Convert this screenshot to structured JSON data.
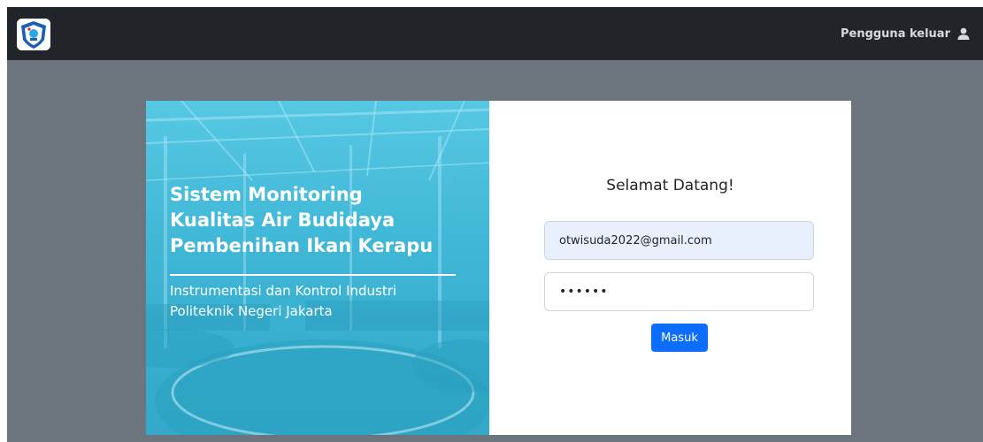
{
  "navbar": {
    "logo_icon": "institution-logo",
    "user_link_label": "Pengguna keluar",
    "user_icon": "user-icon"
  },
  "hero": {
    "title_lines": [
      "Sistem Monitoring",
      "Kualitas Air Budidaya",
      "Pembenihan Ikan Kerapu"
    ],
    "subtitle_lines": [
      "Instrumentasi dan Kontrol Industri",
      "Politeknik Negeri Jakarta"
    ]
  },
  "login": {
    "heading": "Selamat Datang!",
    "email_value": "otwisuda2022@gmail.com",
    "password_value": "••••••",
    "submit_label": "Masuk"
  },
  "colors": {
    "navbar": "#212529",
    "page_background": "#6c757d",
    "hero_tint": "#3fb6d6",
    "primary_button": "#0d6efd",
    "autofill_field": "#e8f0fe"
  }
}
